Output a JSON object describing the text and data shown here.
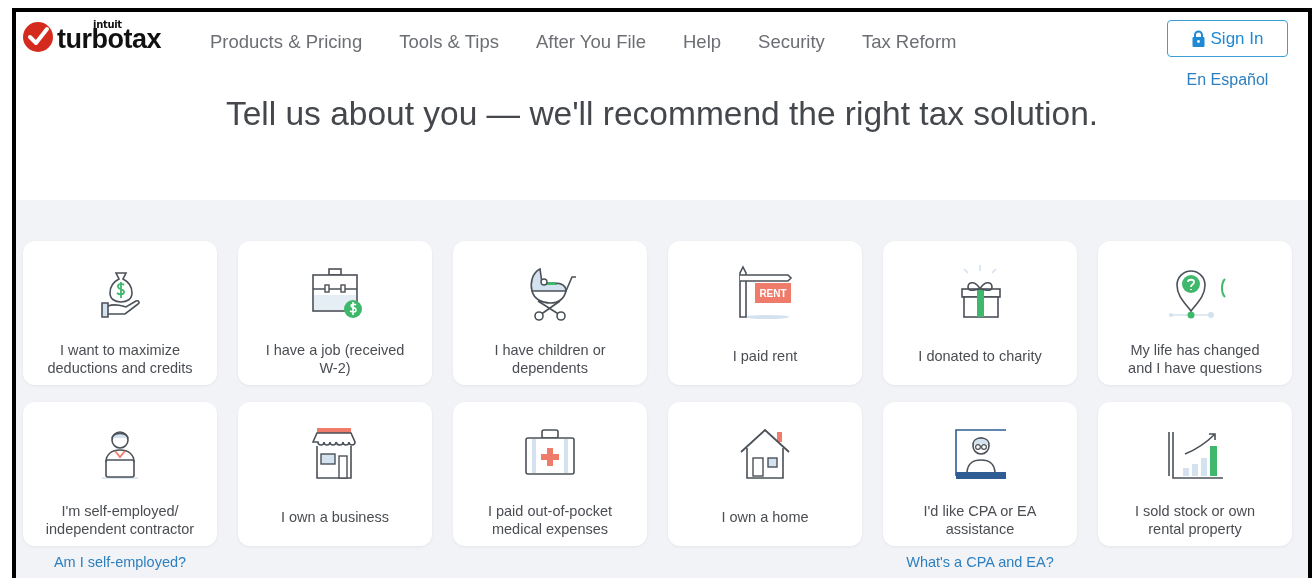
{
  "logo": {
    "maker": "intuit",
    "product": "turbotax"
  },
  "nav": [
    {
      "label": "Products & Pricing"
    },
    {
      "label": "Tools & Tips"
    },
    {
      "label": "After You File"
    },
    {
      "label": "Help"
    },
    {
      "label": "Security"
    },
    {
      "label": "Tax Reform"
    }
  ],
  "sign_in": {
    "label": "Sign In"
  },
  "language_link": "En Español",
  "heading": "Tell us about you — we'll recommend the right tax solution.",
  "cards": [
    {
      "kind": "money",
      "label": "I want to maximize deductions and credits"
    },
    {
      "kind": "job",
      "label": "I have a job (received W-2)"
    },
    {
      "kind": "children",
      "label": "I have children or dependents"
    },
    {
      "kind": "rent",
      "label": "I paid rent",
      "sign": "RENT"
    },
    {
      "kind": "charity",
      "label": "I donated to charity"
    },
    {
      "kind": "life",
      "label": "My life has changed and I have questions"
    },
    {
      "kind": "self",
      "label": "I'm self-employed/ independent contractor",
      "help_link": "Am I self-employed?"
    },
    {
      "kind": "business",
      "label": "I own a business"
    },
    {
      "kind": "medical",
      "label": "I paid out-of-pocket medical expenses"
    },
    {
      "kind": "home",
      "label": "I own a home"
    },
    {
      "kind": "cpa",
      "label": "I'd like CPA or EA assistance",
      "help_link": "What's a CPA and EA?"
    },
    {
      "kind": "stock",
      "label": "I sold stock or own rental property"
    }
  ]
}
